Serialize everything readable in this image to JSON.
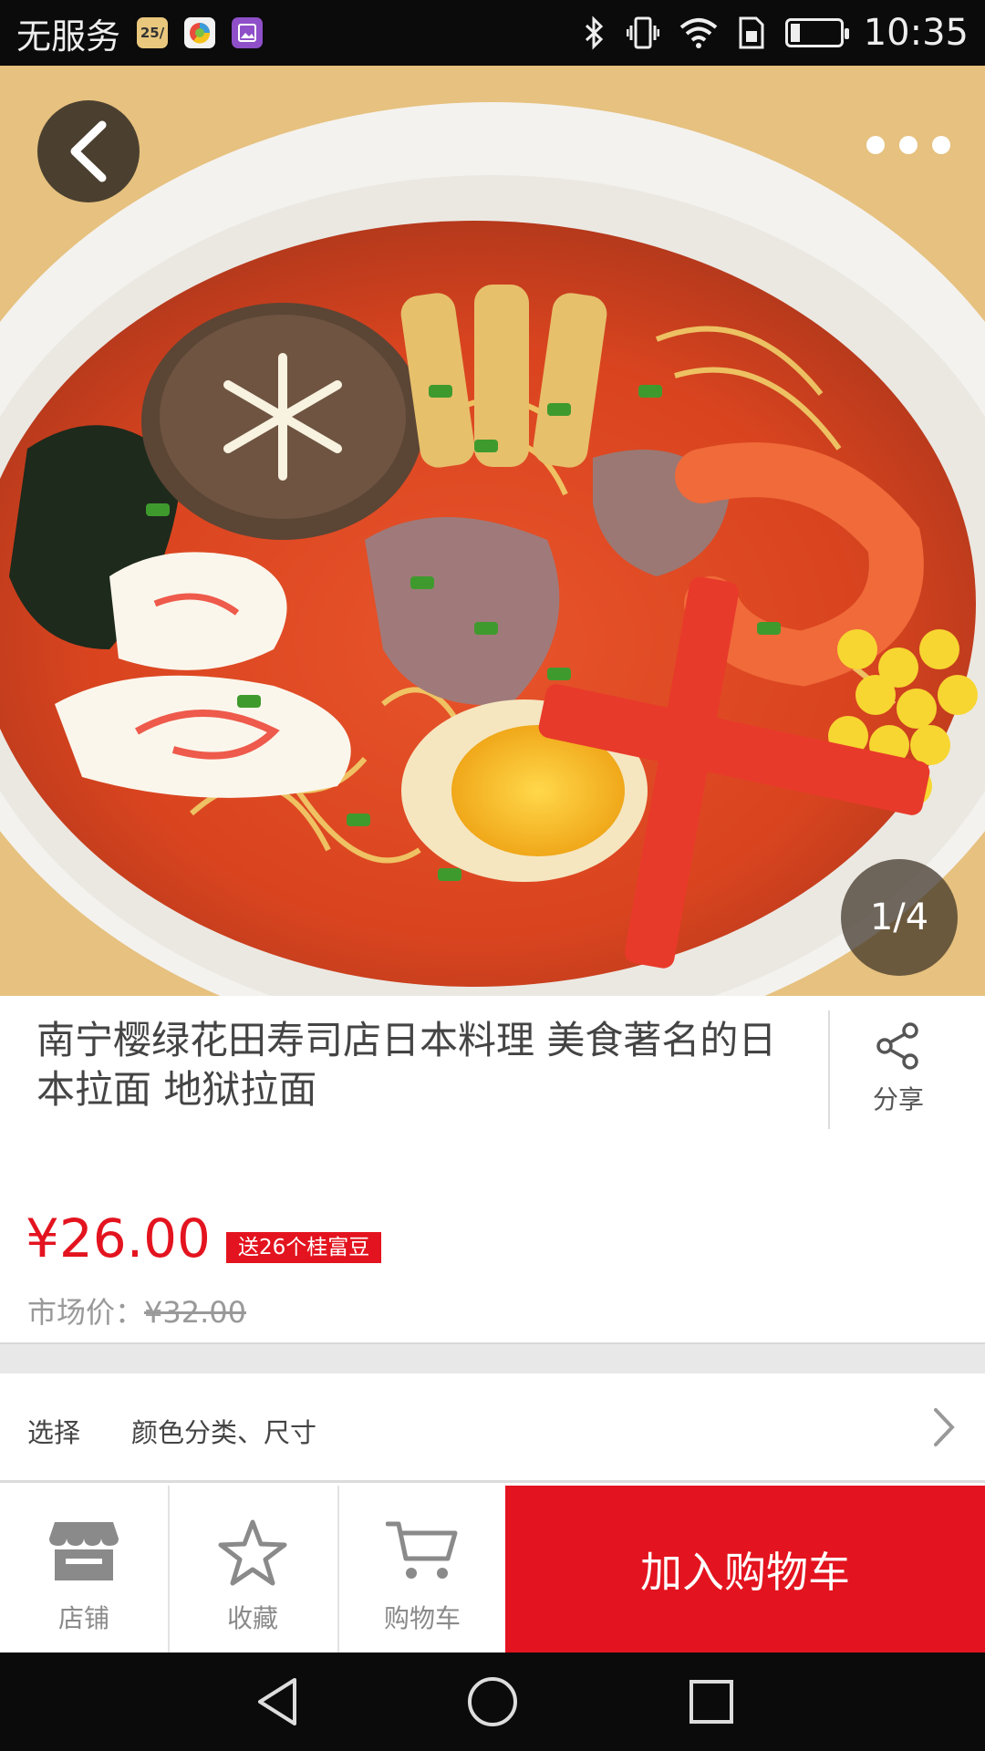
{
  "status_bar": {
    "carrier": "无服务",
    "calendar_badge": "25/",
    "time": "10:35",
    "battery_level": 0.2,
    "icons": [
      "calendar-icon",
      "browser-icon",
      "gallery-icon",
      "bluetooth-icon",
      "vibrate-icon",
      "wifi-icon",
      "sim-icon",
      "battery-icon"
    ]
  },
  "hero": {
    "image_counter": "1/4",
    "image_index": 1,
    "image_total": 4,
    "back_icon": "chevron-left-icon",
    "more_icon": "more-dots-icon"
  },
  "product": {
    "title": "南宁樱绿花田寿司店日本料理 美食著名的日本拉面  地狱拉面",
    "share_label": "分享",
    "price": "¥26.00",
    "bonus_tag": "送26个桂富豆",
    "market_price_label": "市场价：",
    "market_price": "¥32.00"
  },
  "options": {
    "label": "选择",
    "value": "颜色分类、尺寸"
  },
  "bottom_bar": {
    "store_label": "店铺",
    "favorite_label": "收藏",
    "cart_label": "购物车",
    "add_to_cart_label": "加入购物车"
  },
  "colors": {
    "accent": "#e3141f",
    "status_bar": "#0b0b0b"
  }
}
